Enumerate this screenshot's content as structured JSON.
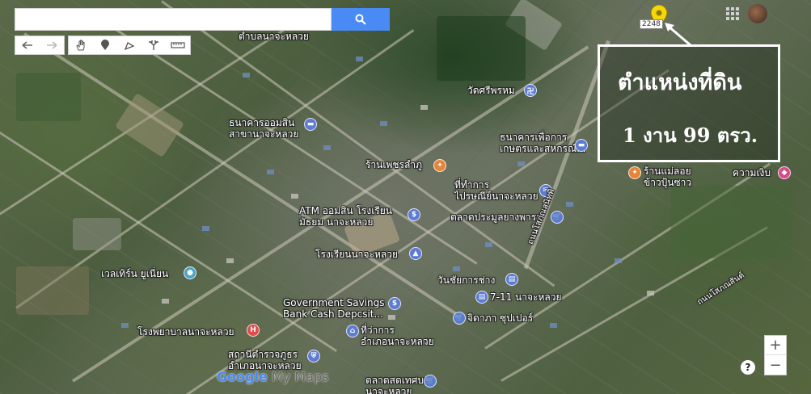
{
  "search": {
    "placeholder": ""
  },
  "toolbar": {
    "undo_icon": "undo-arrow-icon",
    "redo_icon": "redo-arrow-icon",
    "hand_icon": "hand-pan-icon",
    "marker_icon": "add-marker-icon",
    "line_icon": "draw-line-icon",
    "directions_icon": "directions-icon",
    "measure_icon": "ruler-icon"
  },
  "labels": {
    "top_partial": "ตำบลนาจะหลวย",
    "bank_gsb": "ธนาคารออมสิน\nสาขานาจะหลวย",
    "temple": "วัดศรีพรหม",
    "bank_baac": "ธนาคารเพื่อการ\nเกษตรและสหกรณ์...",
    "jewelry": "ร้านเพชรลำภู",
    "post_office": "ที่ทำการ\nไปรษณีย์นาจะหลวย",
    "atm_school": "ATM ออมสิน โรงเรียน\nมัธยม นาจะหลวย",
    "market": "ตลาดประมูลยางพารา",
    "mae_loy": "ร้านแม่ลอย\nข้าวปุ้นซาว",
    "kwam_ngam": "ความเงิบ",
    "school": "โรงเรียนนาจะหลวย",
    "clinic": "เวลเทิร์น ยูเนี่ยน",
    "wunchai": "วันชัยการช่าง",
    "gsb_atm": "Government Savings\nBank Cash Depcsit...",
    "seven": "7-11 นาจะหลวย",
    "jidapa": "จิดาภา ซุปเปอร์",
    "hospital": "โรงพยาบาลนาจะหลวย",
    "district_office": "ที่ว่าการ\nอำเภอนาจะหลวย",
    "police": "สถานีตำรวจภูธร\nอำเภอนาจะหลวย",
    "fresh_market": "ตลาดสดเทศบาล\nนาจะหลวย",
    "road_sophon": "ถนนโสภณสนิทพิ",
    "road_right": "ถนนโสภณสันต์"
  },
  "annotation": {
    "line1": "ตำแหน่งที่ดิน",
    "line2": "1 งาน 99 ตรว."
  },
  "marker": {
    "road_badge": "2248",
    "color": "#f5d60a"
  },
  "zoom": {
    "in": "+",
    "out": "−"
  },
  "help": "?",
  "logo": {
    "google": "Google",
    "mymaps": " My Maps"
  },
  "colors": {
    "search_button": "#4a8af4"
  }
}
